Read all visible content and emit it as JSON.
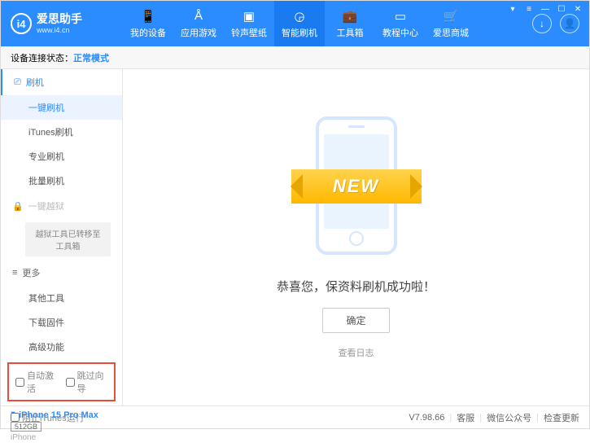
{
  "header": {
    "logo_title": "爱思助手",
    "logo_sub": "www.i4.cn",
    "nav": [
      {
        "label": "我的设备"
      },
      {
        "label": "应用游戏"
      },
      {
        "label": "铃声壁纸"
      },
      {
        "label": "智能刷机"
      },
      {
        "label": "工具箱"
      },
      {
        "label": "教程中心"
      },
      {
        "label": "爱思商城"
      }
    ]
  },
  "status": {
    "label": "设备连接状态：",
    "mode": "正常模式"
  },
  "sidebar": {
    "flash_header": "刷机",
    "items_flash": [
      {
        "label": "一键刷机"
      },
      {
        "label": "iTunes刷机"
      },
      {
        "label": "专业刷机"
      },
      {
        "label": "批量刷机"
      }
    ],
    "jailbreak_header": "一键越狱",
    "jailbreak_note": "越狱工具已转移至工具箱",
    "more_header": "更多",
    "items_more": [
      {
        "label": "其他工具"
      },
      {
        "label": "下载固件"
      },
      {
        "label": "高级功能"
      }
    ],
    "auto_activate": "自动激活",
    "skip_guide": "跳过向导"
  },
  "device": {
    "name": "iPhone 15 Pro Max",
    "storage": "512GB",
    "type": "iPhone"
  },
  "main": {
    "ribbon": "NEW",
    "congrats": "恭喜您，保资料刷机成功啦！",
    "ok": "确定",
    "view_log": "查看日志"
  },
  "footer": {
    "block_itunes": "阻止iTunes运行",
    "version": "V7.98.66",
    "links": [
      "客服",
      "微信公众号",
      "检查更新"
    ]
  }
}
